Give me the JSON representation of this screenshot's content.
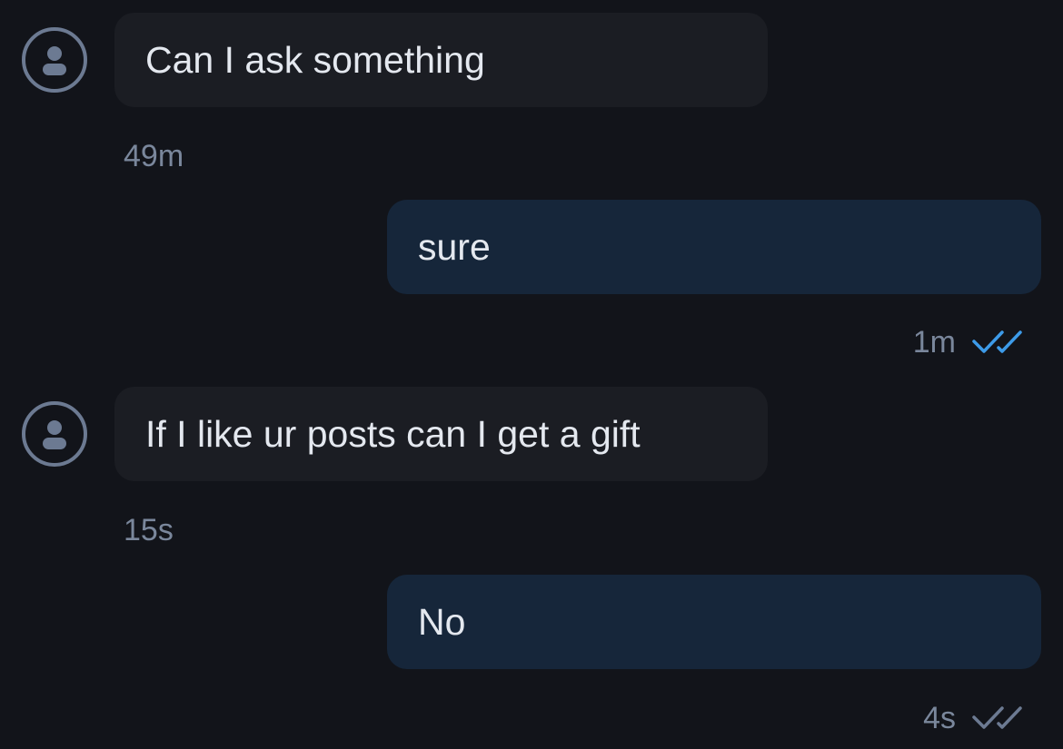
{
  "colors": {
    "background": "#12141a",
    "incoming_bubble": "#1b1d23",
    "outgoing_bubble": "#16263a",
    "text": "#e4e8ef",
    "timestamp": "#7a879c",
    "read_check": "#3d9be9",
    "delivered_check": "#6c7a92",
    "avatar": "#6c7a92"
  },
  "messages": [
    {
      "direction": "incoming",
      "text": "Can I ask something",
      "time": "49m",
      "avatar_icon": "user-avatar-icon"
    },
    {
      "direction": "outgoing",
      "text": "sure",
      "time": "1m",
      "status_icon": "double-check-read-icon"
    },
    {
      "direction": "incoming",
      "text": "If I like ur posts can I get a gift",
      "time": "15s",
      "avatar_icon": "user-avatar-icon"
    },
    {
      "direction": "outgoing",
      "text": "No",
      "time": "4s",
      "status_icon": "double-check-delivered-icon"
    }
  ]
}
